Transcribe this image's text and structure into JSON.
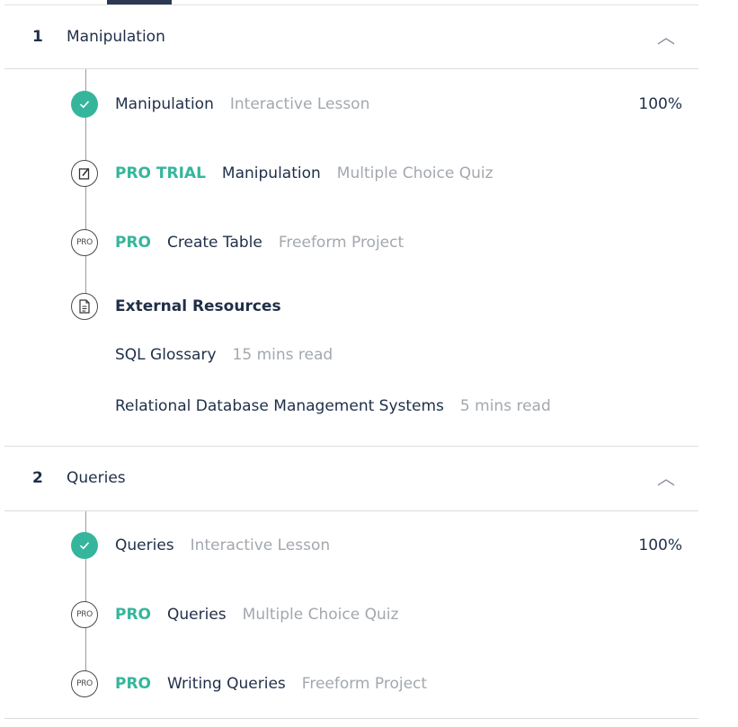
{
  "colors": {
    "accent": "#35b69c",
    "text": "#1f2f48",
    "muted": "#a3a8ae"
  },
  "sections": [
    {
      "number": "1",
      "title": "Manipulation",
      "toggle_icon": "chevron-up-icon",
      "items": [
        {
          "status": "completed",
          "icon": "check-icon",
          "badge": "",
          "name": "Manipulation",
          "type": "Interactive Lesson",
          "progress": "100%"
        },
        {
          "status": "pro-trial",
          "icon": "quiz-icon",
          "badge": "PRO TRIAL",
          "name": "Manipulation",
          "type": "Multiple Choice Quiz"
        },
        {
          "status": "pro",
          "icon": "pro-icon",
          "icon_text": "PRO",
          "badge": "PRO",
          "name": "Create Table",
          "type": "Freeform Project"
        }
      ],
      "resources": {
        "icon": "document-icon",
        "title": "External Resources",
        "items": [
          {
            "name": "SQL Glossary",
            "meta": "15 mins read"
          },
          {
            "name": "Relational Database Management Systems",
            "meta": "5 mins read"
          }
        ]
      }
    },
    {
      "number": "2",
      "title": "Queries",
      "toggle_icon": "chevron-up-icon",
      "items": [
        {
          "status": "completed",
          "icon": "check-icon",
          "badge": "",
          "name": "Queries",
          "type": "Interactive Lesson",
          "progress": "100%"
        },
        {
          "status": "pro",
          "icon": "pro-icon",
          "icon_text": "PRO",
          "badge": "PRO",
          "name": "Queries",
          "type": "Multiple Choice Quiz"
        },
        {
          "status": "pro",
          "icon": "pro-icon",
          "icon_text": "PRO",
          "badge": "PRO",
          "name": "Writing Queries",
          "type": "Freeform Project"
        }
      ]
    }
  ]
}
